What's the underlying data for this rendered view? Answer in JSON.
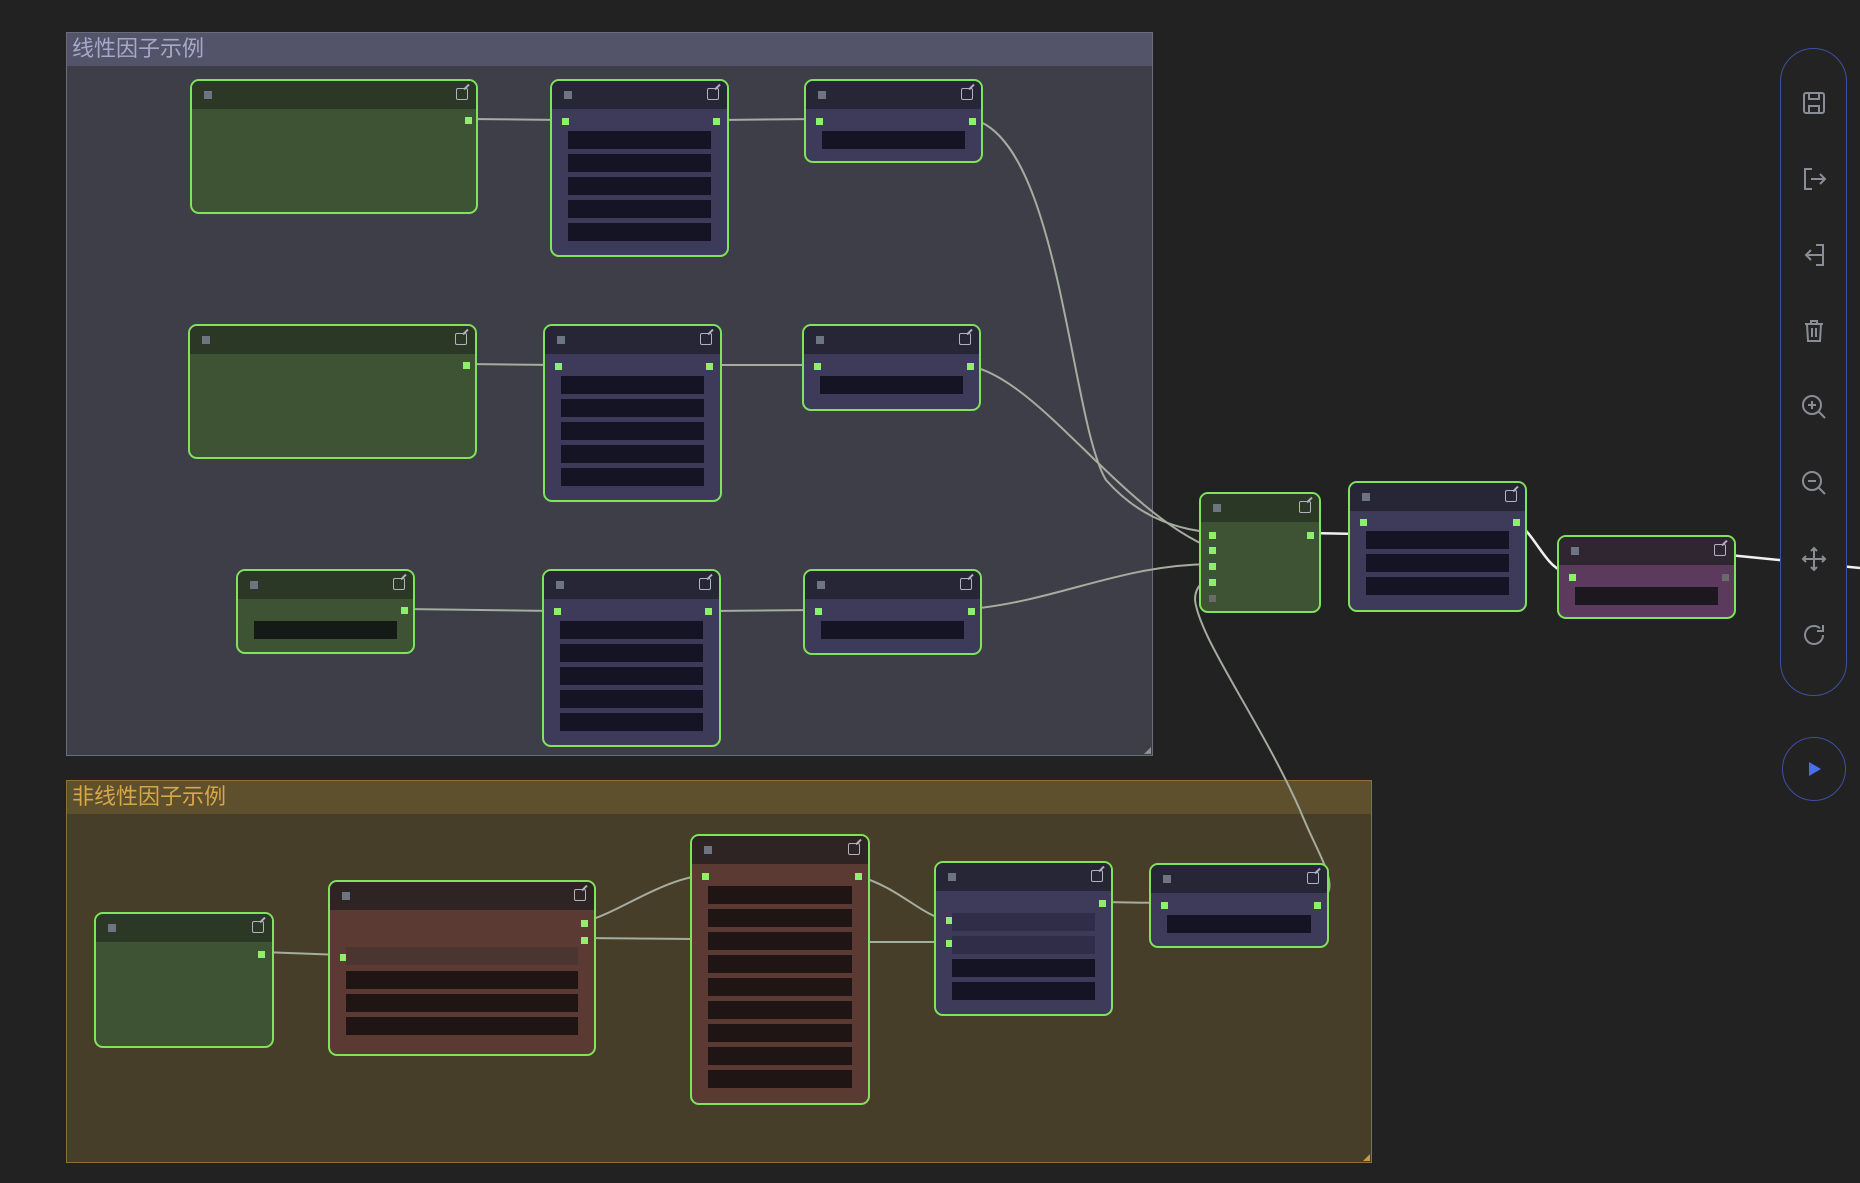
{
  "canvas": {
    "groups": [
      {
        "title": "线性因子示例"
      },
      {
        "title": "非线性因子示例"
      }
    ]
  },
  "toolbar": {
    "buttons": [
      "save-icon",
      "export-icon",
      "import-icon",
      "delete-icon",
      "zoom-in-icon",
      "zoom-out-icon",
      "fit-view-icon",
      "refresh-icon"
    ],
    "run_button": "play-icon"
  },
  "colors": {
    "background": "#222222",
    "node_border": "#7fe35c",
    "group_linear": "#3d3e47",
    "group_nonlinear": "#463e28",
    "group_nonlinear_title": "#d6a848",
    "accent": "#3d4fa0"
  }
}
